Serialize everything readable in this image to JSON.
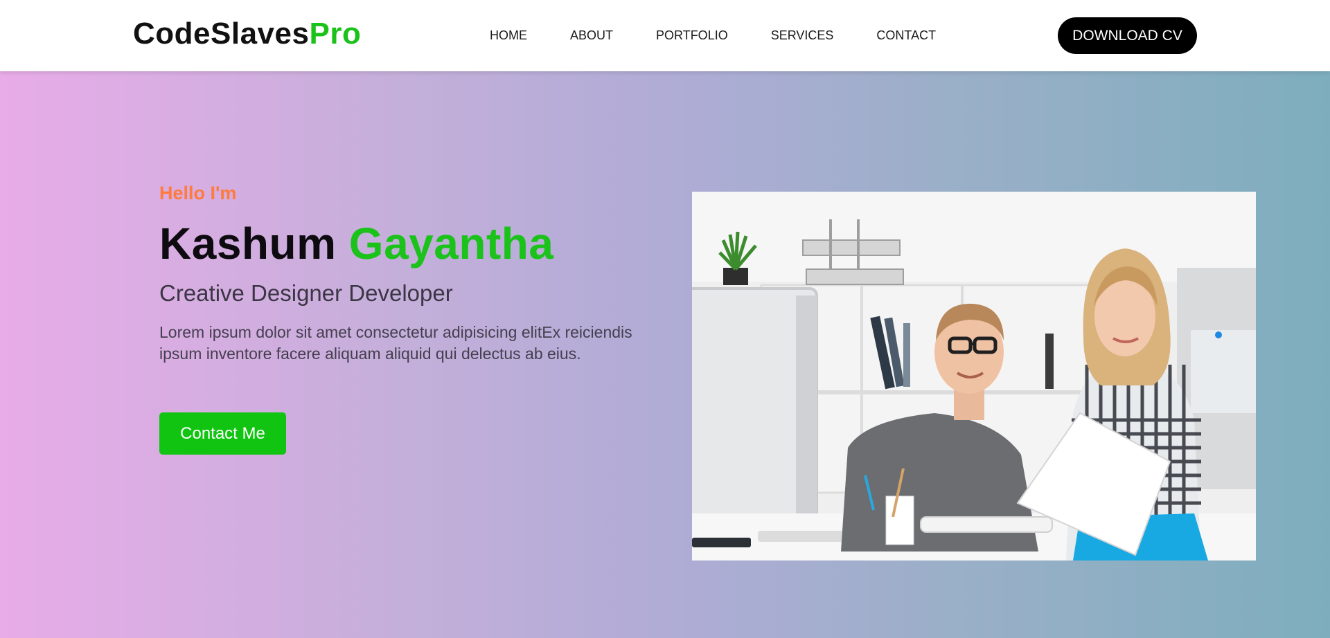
{
  "header": {
    "logo_main": "CodeSlaves",
    "logo_accent": "Pro",
    "nav": [
      {
        "label": "HOME"
      },
      {
        "label": "ABOUT"
      },
      {
        "label": "PORTFOLIO"
      },
      {
        "label": "SERVICES"
      },
      {
        "label": "CONTACT"
      }
    ],
    "download_label": "DOWNLOAD CV"
  },
  "hero": {
    "greeting": "Hello I'm",
    "first_name": "Kashum",
    "last_name": "Gayantha",
    "role": "Creative Designer Developer",
    "description": "Lorem ipsum dolor sit amet consectetur adipisicing elitEx reiciendis ipsum inventore facere aliquam aliquid qui delectus ab eius.",
    "contact_label": "Contact Me"
  },
  "colors": {
    "accent_green": "#1ac21a",
    "greeting_orange": "#ff7a3d",
    "button_black": "#000000",
    "gradient_start": "#e8ace8",
    "gradient_end": "#7eaebe"
  },
  "image": {
    "subject": "office-team-photo"
  }
}
